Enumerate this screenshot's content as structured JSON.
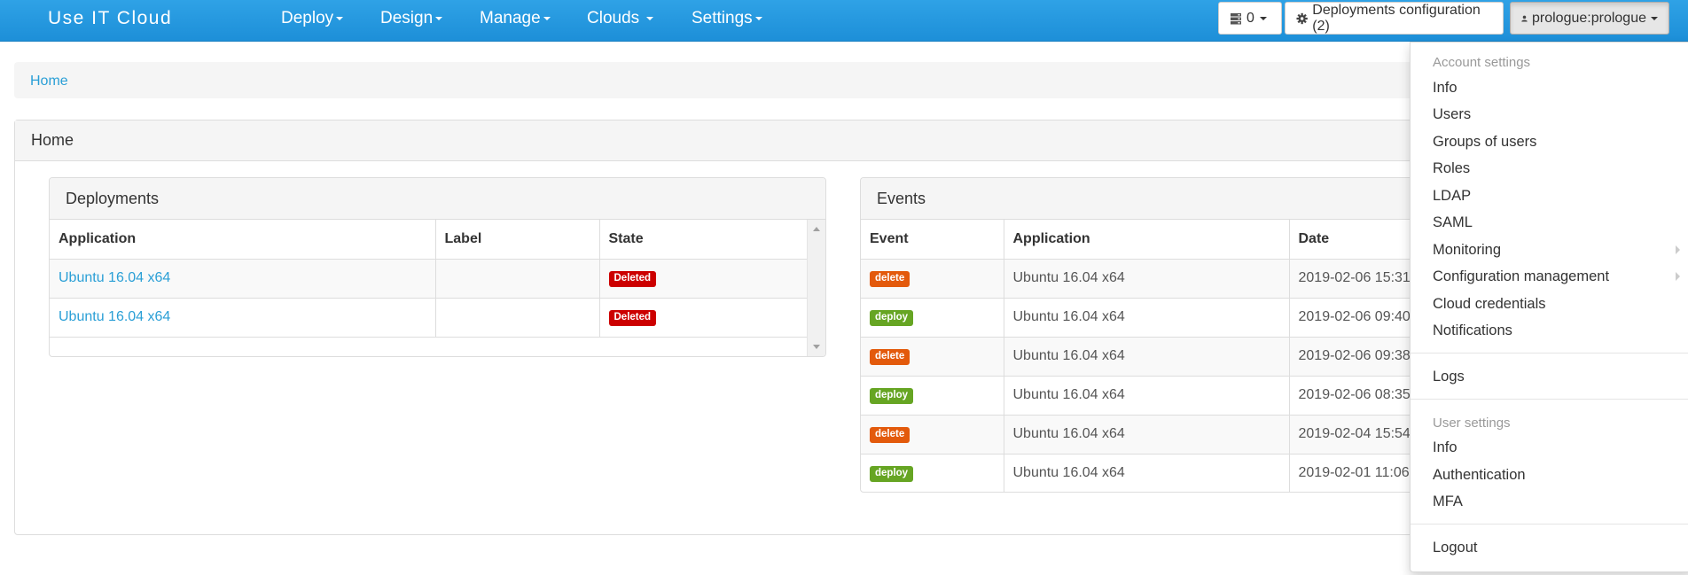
{
  "navbar": {
    "brand": "Use IT Cloud",
    "menus": [
      "Deploy",
      "Design",
      "Manage",
      "Clouds",
      "Settings"
    ],
    "servers_count": "0",
    "deployments_config_label": "Deployments configuration (2)",
    "user_label": "prologue:prologue"
  },
  "breadcrumb": {
    "home": "Home"
  },
  "home_panel": {
    "title": "Home"
  },
  "deployments": {
    "title": "Deployments",
    "columns": [
      "Application",
      "Label",
      "State"
    ],
    "rows": [
      {
        "application": "Ubuntu 16.04 x64",
        "label": "",
        "state": "Deleted"
      },
      {
        "application": "Ubuntu 16.04 x64",
        "label": "",
        "state": "Deleted"
      }
    ]
  },
  "events": {
    "title": "Events",
    "columns": [
      "Event",
      "Application",
      "Date"
    ],
    "rows": [
      {
        "event": "delete",
        "application": "Ubuntu 16.04 x64",
        "date": "2019-02-06 15:31"
      },
      {
        "event": "deploy",
        "application": "Ubuntu 16.04 x64",
        "date": "2019-02-06 09:40"
      },
      {
        "event": "delete",
        "application": "Ubuntu 16.04 x64",
        "date": "2019-02-06 09:38"
      },
      {
        "event": "deploy",
        "application": "Ubuntu 16.04 x64",
        "date": "2019-02-06 08:35"
      },
      {
        "event": "delete",
        "application": "Ubuntu 16.04 x64",
        "date": "2019-02-04 15:54"
      },
      {
        "event": "deploy",
        "application": "Ubuntu 16.04 x64",
        "date": "2019-02-01 11:06"
      }
    ]
  },
  "user_menu": {
    "account_header": "Account settings",
    "account_items": [
      "Info",
      "Users",
      "Groups of users",
      "Roles",
      "LDAP",
      "SAML",
      "Monitoring",
      "Configuration management",
      "Cloud credentials",
      "Notifications"
    ],
    "logs": "Logs",
    "user_header": "User settings",
    "user_items": [
      "Info",
      "Authentication",
      "MFA"
    ],
    "logout": "Logout"
  },
  "colors": {
    "navbar": "#2a9fd6",
    "link": "#2a9fd6",
    "deleted": "#cc0000",
    "delete": "#e35a0c",
    "deploy": "#66a523"
  },
  "icons": [
    "server-icon",
    "gear-icon",
    "user-icon"
  ]
}
